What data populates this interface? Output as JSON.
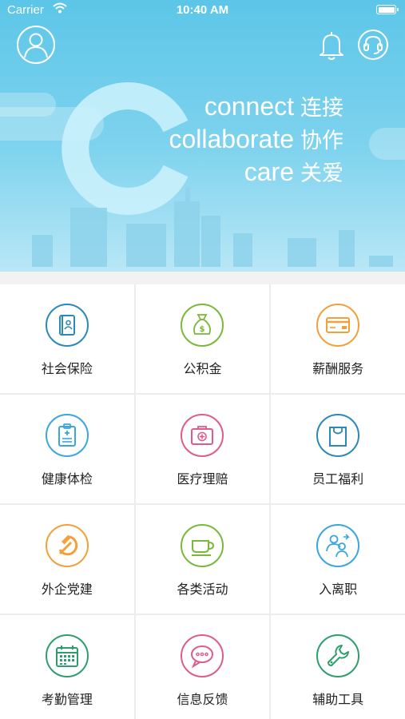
{
  "status_bar": {
    "carrier": "Carrier",
    "time": "10:40 AM",
    "battery_level": 1.0
  },
  "header": {
    "avatar_icon": "user-avatar-icon",
    "bell_icon": "bell-icon",
    "support_icon": "headset-support-icon"
  },
  "banner": {
    "logo_letter": "C",
    "lines": [
      {
        "en": "connect",
        "cn": "连接"
      },
      {
        "en": "collaborate",
        "cn": "协作"
      },
      {
        "en": "care",
        "cn": "关爱"
      }
    ]
  },
  "services": [
    {
      "label": "社会保险",
      "icon": "id-card-icon",
      "color": "#2a89b8"
    },
    {
      "label": "公积金",
      "icon": "money-bag-icon",
      "color": "#7ab83a"
    },
    {
      "label": "薪酬服务",
      "icon": "credit-card-icon",
      "color": "#f2a03a"
    },
    {
      "label": "健康体检",
      "icon": "clipboard-icon",
      "color": "#3aa6e0"
    },
    {
      "label": "医疗理赔",
      "icon": "medical-kit-icon",
      "color": "#e05a8a"
    },
    {
      "label": "员工福利",
      "icon": "shopping-bag-icon",
      "color": "#2a89b8"
    },
    {
      "label": "外企党建",
      "icon": "hammer-sickle-icon",
      "color": "#f2a03a"
    },
    {
      "label": "各类活动",
      "icon": "coffee-cup-icon",
      "color": "#7ab83a"
    },
    {
      "label": "入离职",
      "icon": "people-transfer-icon",
      "color": "#3aa6e0"
    },
    {
      "label": "考勤管理",
      "icon": "calendar-icon",
      "color": "#2e9e6e"
    },
    {
      "label": "信息反馈",
      "icon": "chat-bubble-icon",
      "color": "#e05a8a"
    },
    {
      "label": "辅助工具",
      "icon": "wrench-icon",
      "color": "#2e9e6e"
    }
  ]
}
